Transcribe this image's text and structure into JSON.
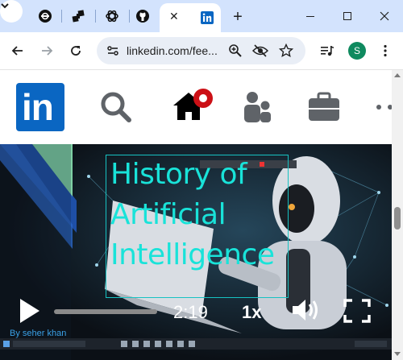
{
  "browser": {
    "tabs": [
      {
        "name": "openai-tab",
        "icon": "openai-icon"
      },
      {
        "name": "network-tab",
        "icon": "link-icon"
      },
      {
        "name": "chatgpt-tab",
        "icon": "openai-icon"
      },
      {
        "name": "github-tab",
        "icon": "github-icon"
      },
      {
        "name": "linkedin-tab",
        "icon": "linkedin-icon",
        "active": true
      }
    ],
    "tab_close_glyph": "✕",
    "new_tab_glyph": "+",
    "window_controls": {
      "minimize": "—",
      "maximize": "☐",
      "close": "✕"
    }
  },
  "toolbar": {
    "url": "linkedin.com/fee...",
    "profile_initial": "S"
  },
  "linkedin": {
    "logo_text": "in",
    "brand_color": "#0a66c2",
    "home_badge_color": "#cc1016"
  },
  "video": {
    "title_lines": [
      "History of",
      "Artificial",
      "Intelligence"
    ],
    "time": "2:19",
    "speed": "1x",
    "byline": "By seher khan",
    "title_color": "#19e3d9",
    "progress_fraction": 0.0
  }
}
